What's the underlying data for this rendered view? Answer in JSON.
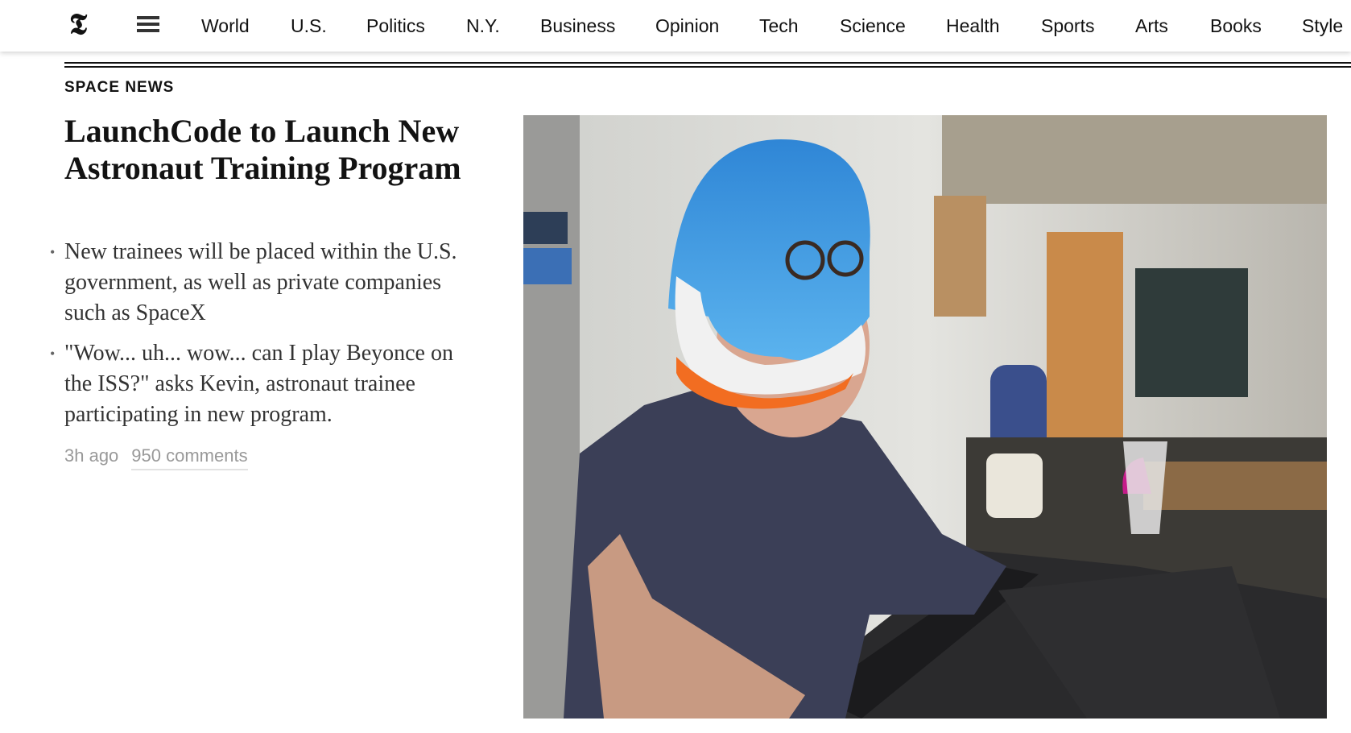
{
  "nav": {
    "logo_icon": "nyt-logo-icon",
    "menu_icon": "hamburger-icon",
    "items": [
      "World",
      "U.S.",
      "Politics",
      "N.Y.",
      "Business",
      "Opinion",
      "Tech",
      "Science",
      "Health",
      "Sports",
      "Arts",
      "Books",
      "Style"
    ]
  },
  "story": {
    "kicker": "SPACE NEWS",
    "headline": "LaunchCode to Launch New Astronaut Training Program",
    "bullets": [
      "New trainees will be placed within the U.S. government, as well as private companies such as SpaceX",
      "\"Wow... uh... wow... can I play Beyonce on the ISS?\" asks Kevin, astronaut trainee participating in new program."
    ],
    "time": "3h ago",
    "comments": "950 comments"
  },
  "colors": {
    "text": "#121212",
    "summary": "#333333",
    "meta": "#999999"
  }
}
